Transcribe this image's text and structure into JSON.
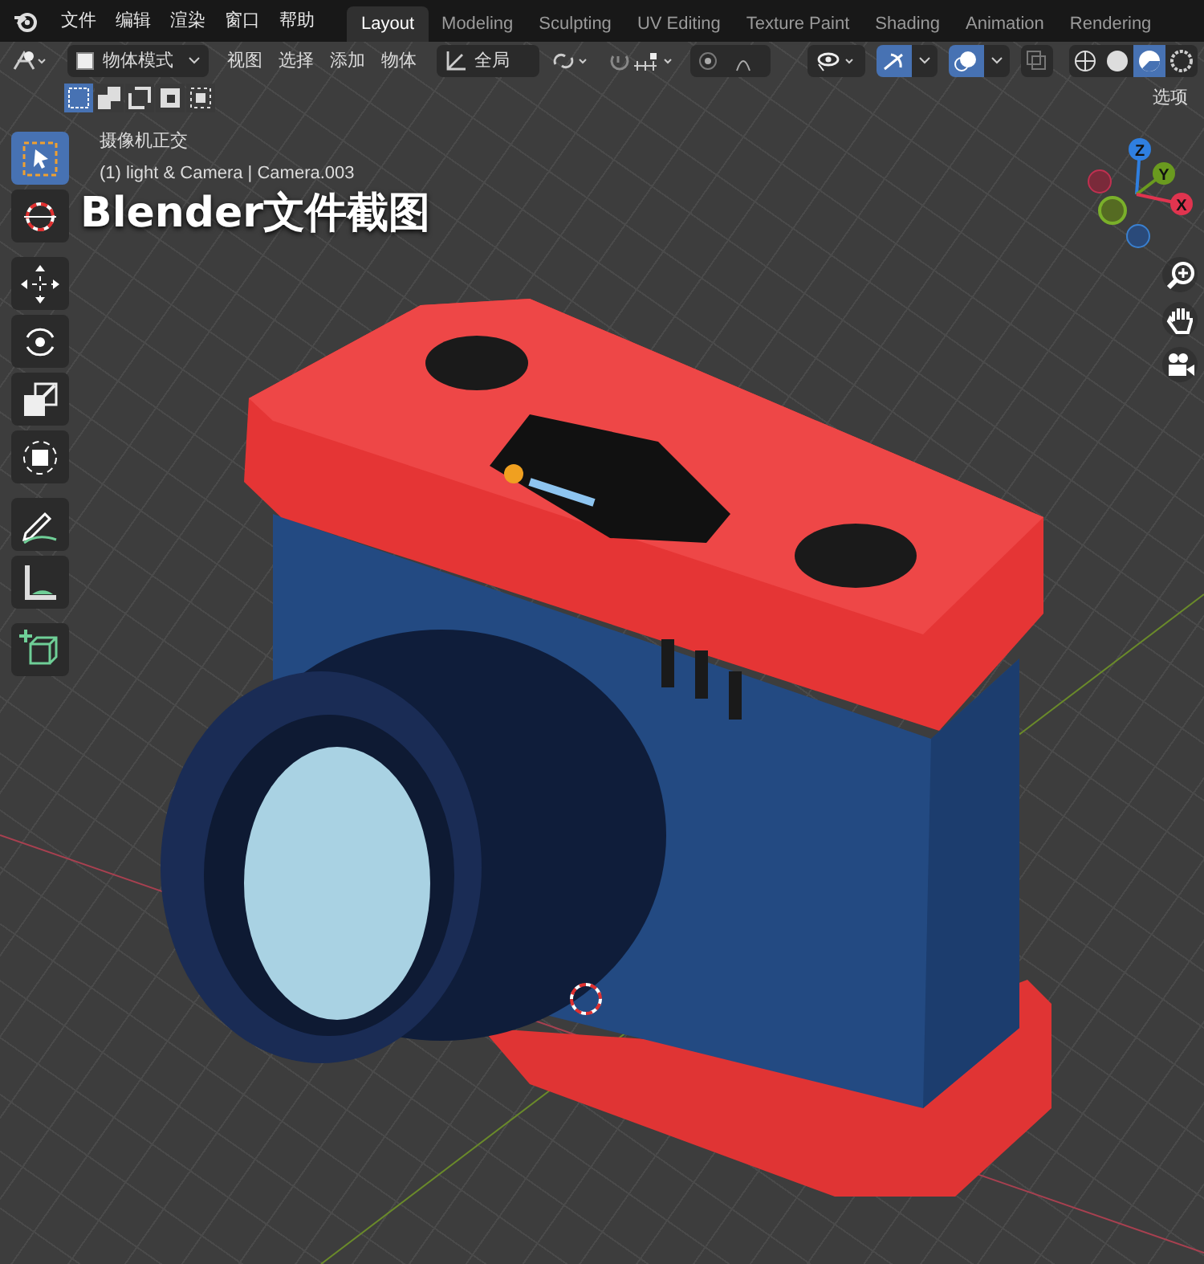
{
  "menu": [
    "文件",
    "编辑",
    "渲染",
    "窗口",
    "帮助"
  ],
  "workspaces": [
    {
      "label": "Layout",
      "selected": true
    },
    {
      "label": "Modeling",
      "selected": false
    },
    {
      "label": "Sculpting",
      "selected": false
    },
    {
      "label": "UV Editing",
      "selected": false
    },
    {
      "label": "Texture Paint",
      "selected": false
    },
    {
      "label": "Shading",
      "selected": false
    },
    {
      "label": "Animation",
      "selected": false
    },
    {
      "label": "Rendering",
      "selected": false
    }
  ],
  "header": {
    "mode": "物体模式",
    "menus": [
      "视图",
      "选择",
      "添加",
      "物体"
    ],
    "orientation": "全局",
    "toggles": [
      {
        "kind": "visibility",
        "selected": false
      },
      {
        "kind": "gizmo",
        "selected": true
      },
      {
        "kind": "overlay",
        "selected": true
      },
      {
        "kind": "xray",
        "selected": false
      }
    ],
    "shading": [
      {
        "kind": "wireframe",
        "selected": false
      },
      {
        "kind": "solid",
        "selected": false
      },
      {
        "kind": "material",
        "selected": true
      },
      {
        "kind": "rendered",
        "selected": false
      }
    ]
  },
  "select_modes": [
    {
      "selected": true
    },
    {
      "selected": false
    },
    {
      "selected": false
    },
    {
      "selected": false
    },
    {
      "selected": false
    }
  ],
  "options_label": "选项",
  "viewport": {
    "view_name": "摄像机正交",
    "collection": "(1) light & Camera | Camera.003"
  },
  "caption": "Blender文件截图",
  "tools": [
    {
      "kind": "select",
      "selected": true
    },
    {
      "kind": "cursor",
      "selected": false
    },
    {
      "kind": "move",
      "selected": false
    },
    {
      "kind": "rotate",
      "selected": false
    },
    {
      "kind": "scale",
      "selected": false
    },
    {
      "kind": "transform",
      "selected": false
    },
    {
      "kind": "annotate",
      "selected": false
    },
    {
      "kind": "measure",
      "selected": false
    },
    {
      "kind": "add-cube",
      "selected": false
    }
  ],
  "gizmo_axes": [
    {
      "label": "Z",
      "color": "#2f7fe0"
    },
    {
      "label": "Y",
      "color": "#6a9a1f"
    },
    {
      "label": "X",
      "color": "#e0344f"
    }
  ]
}
